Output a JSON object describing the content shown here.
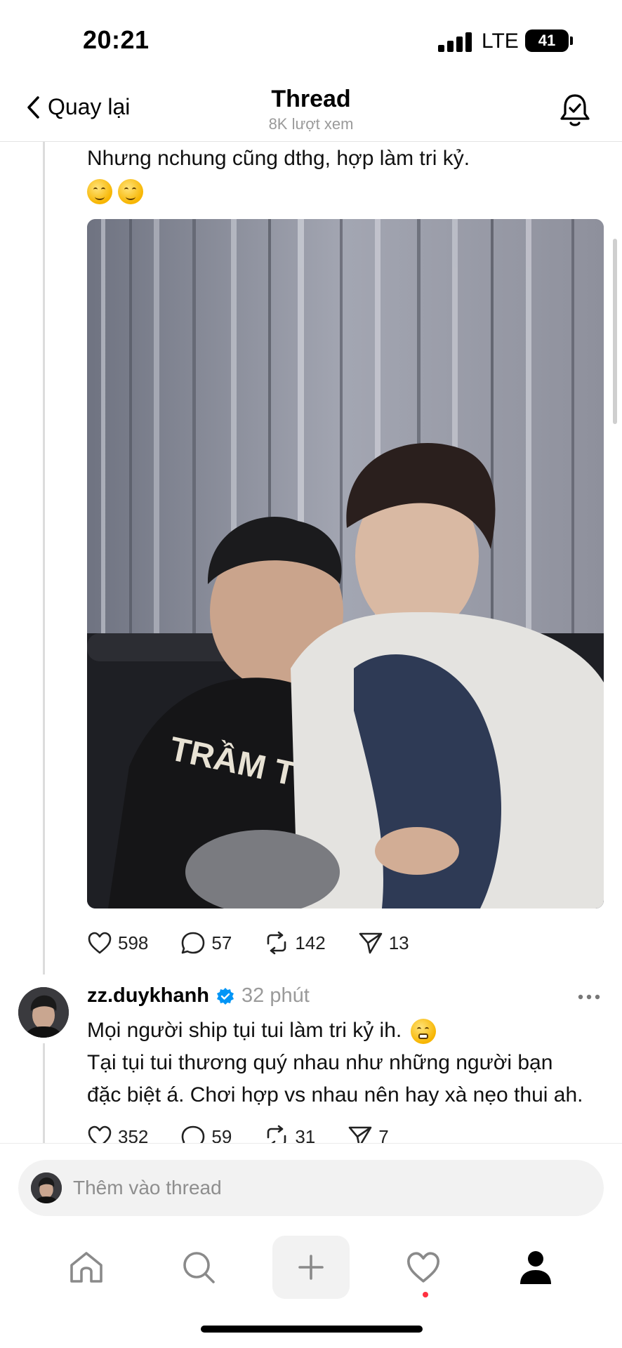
{
  "status_bar": {
    "time": "20:21",
    "network": "LTE",
    "battery": "41"
  },
  "nav": {
    "back_label": "Quay lại",
    "title": "Thread",
    "subtitle": "8K lượt xem"
  },
  "post1": {
    "text": "Nhưng nchung cũng dthg, hợp làm tri kỷ.",
    "emojis": [
      "yum-emoji",
      "yum-emoji"
    ],
    "likes": "598",
    "replies": "57",
    "reposts": "142",
    "shares": "13"
  },
  "post2": {
    "username": "zz.duykhanh",
    "time": "32 phút",
    "line1": "Mọi người ship tụi tui làm tri kỷ ih.",
    "line2": "Tại tụi tui thương quý nhau như những người bạn",
    "line3": "đặc biệt á. Chơi hợp vs nhau nên hay xà nẹo thui ah.",
    "likes": "352",
    "replies": "59",
    "reposts": "31",
    "shares": "7"
  },
  "composer": {
    "placeholder": "Thêm vào thread"
  },
  "tabbar": {
    "items": [
      "home-icon",
      "search-icon",
      "plus-icon",
      "heart-icon",
      "profile-icon"
    ]
  },
  "colors": {
    "verified": "#0095f6",
    "notification_dot": "#ff3040",
    "muted_text": "#9a9a9a"
  }
}
